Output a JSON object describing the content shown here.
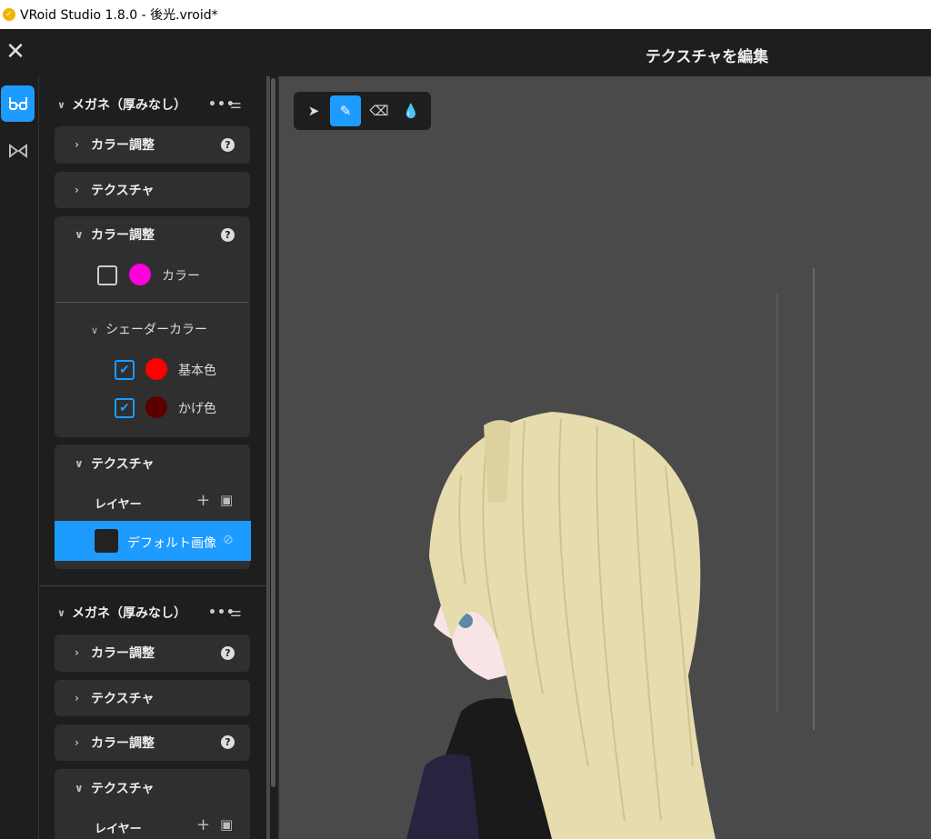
{
  "window": {
    "title": "VRoid Studio 1.8.0 - 後光.vroid*"
  },
  "header": {
    "title": "テクスチャを編集"
  },
  "rail": {
    "items": [
      {
        "icon": "glasses-icon",
        "active": true
      },
      {
        "icon": "bowtie-icon",
        "active": false
      }
    ]
  },
  "panel": {
    "groups": [
      {
        "title": "メガネ（厚みなし）",
        "cards": [
          {
            "label": "カラー調整",
            "expanded": false
          },
          {
            "label": "テクスチャ",
            "expanded": false
          },
          {
            "label": "カラー調整",
            "expanded": true,
            "color": {
              "label": "カラー",
              "value": "#ff00dd",
              "checked": false
            },
            "shader": {
              "label": "シェーダーカラー",
              "items": [
                {
                  "label": "基本色",
                  "value": "#ff0000",
                  "checked": true
                },
                {
                  "label": "かげ色",
                  "value": "#5a0000",
                  "checked": true
                }
              ]
            }
          },
          {
            "label": "テクスチャ",
            "expanded": true,
            "layers_label": "レイヤー",
            "layers": [
              {
                "name": "デフォルト画像",
                "selected": true
              }
            ]
          }
        ]
      },
      {
        "title": "メガネ（厚みなし）",
        "cards": [
          {
            "label": "カラー調整",
            "expanded": false
          },
          {
            "label": "テクスチャ",
            "expanded": false
          },
          {
            "label": "カラー調整",
            "expanded": false
          },
          {
            "label": "テクスチャ",
            "expanded": true,
            "layers_label": "レイヤー"
          }
        ]
      }
    ]
  },
  "toolbar": {
    "tools": [
      {
        "name": "select",
        "icon": "cursor-icon",
        "active": false
      },
      {
        "name": "pen",
        "icon": "pen-icon",
        "active": true
      },
      {
        "name": "eraser",
        "icon": "eraser-icon",
        "active": false
      },
      {
        "name": "fill",
        "icon": "drop-icon",
        "active": false
      }
    ]
  },
  "colors": {
    "accent": "#1e9bff",
    "panel": "#1e1e1e",
    "card": "#2f2f2f",
    "canvas": "#4a4a4a",
    "hair": "#e6dcae"
  }
}
